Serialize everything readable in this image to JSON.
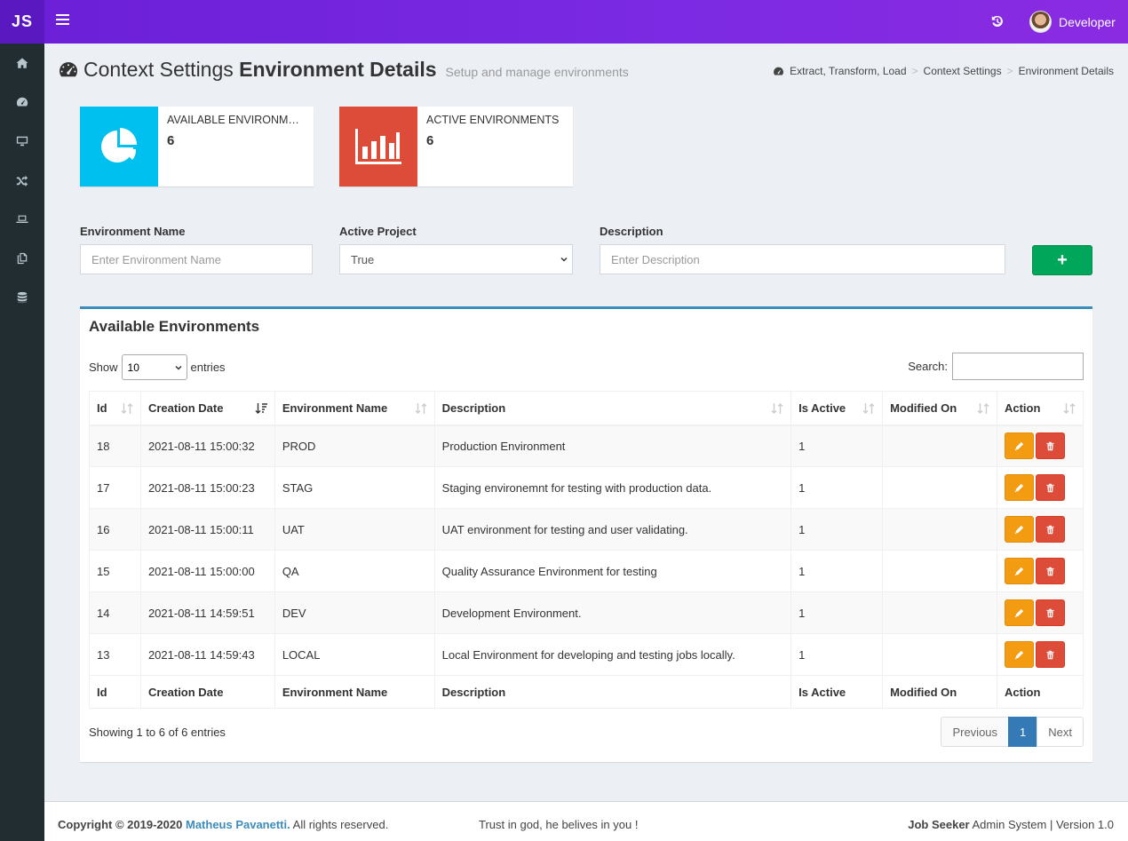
{
  "header": {
    "logo": "JS",
    "username": "Developer"
  },
  "page": {
    "title_light": "Context Settings",
    "title_bold": "Environment Details",
    "subtitle": "Setup and manage environments",
    "breadcrumb": [
      "Extract, Transform, Load",
      "Context Settings",
      "Environment Details"
    ],
    "breadcrumb_sep": ">"
  },
  "stats": [
    {
      "label": "AVAILABLE ENVIRONMENTS",
      "value": "6",
      "color": "#00c0ef",
      "icon": "pie-chart-icon"
    },
    {
      "label": "ACTIVE ENVIRONMENTS",
      "value": "6",
      "color": "#dd4b39",
      "icon": "bar-chart-icon"
    }
  ],
  "form": {
    "env_name_label": "Environment Name",
    "env_name_placeholder": "Enter Environment Name",
    "active_label": "Active Project",
    "active_value": "True",
    "description_label": "Description",
    "description_placeholder": "Enter Description",
    "add_label": "+"
  },
  "table_box": {
    "title": "Available Environments",
    "show_label": "Show",
    "entries_value": "10",
    "entries_label": "entries",
    "search_label": "Search:",
    "columns": [
      "Id",
      "Creation Date",
      "Environment Name",
      "Description",
      "Is Active",
      "Modified On",
      "Action"
    ],
    "rows": [
      {
        "id": "18",
        "created": "2021-08-11 15:00:32",
        "name": "PROD",
        "description": "Production Environment",
        "active": "1",
        "modified": ""
      },
      {
        "id": "17",
        "created": "2021-08-11 15:00:23",
        "name": "STAG",
        "description": "Staging environemnt for testing with production data.",
        "active": "1",
        "modified": ""
      },
      {
        "id": "16",
        "created": "2021-08-11 15:00:11",
        "name": "UAT",
        "description": "UAT environment for testing and user validating.",
        "active": "1",
        "modified": ""
      },
      {
        "id": "15",
        "created": "2021-08-11 15:00:00",
        "name": "QA",
        "description": "Quality Assurance Environment for testing",
        "active": "1",
        "modified": ""
      },
      {
        "id": "14",
        "created": "2021-08-11 14:59:51",
        "name": "DEV",
        "description": "Development Environment.",
        "active": "1",
        "modified": ""
      },
      {
        "id": "13",
        "created": "2021-08-11 14:59:43",
        "name": "LOCAL",
        "description": "Local Environment for developing and testing jobs locally.",
        "active": "1",
        "modified": ""
      }
    ],
    "info": "Showing 1 to 6 of 6 entries",
    "prev": "Previous",
    "page": "1",
    "next": "Next"
  },
  "footer": {
    "copyright": "Copyright © 2019-2020",
    "author": "Matheus Pavanetti.",
    "rights": "All rights reserved.",
    "motto": "Trust in god, he belives in you !",
    "app_bold": "Job Seeker",
    "app_rest": "Admin System",
    "version": "| Version 1.0"
  }
}
